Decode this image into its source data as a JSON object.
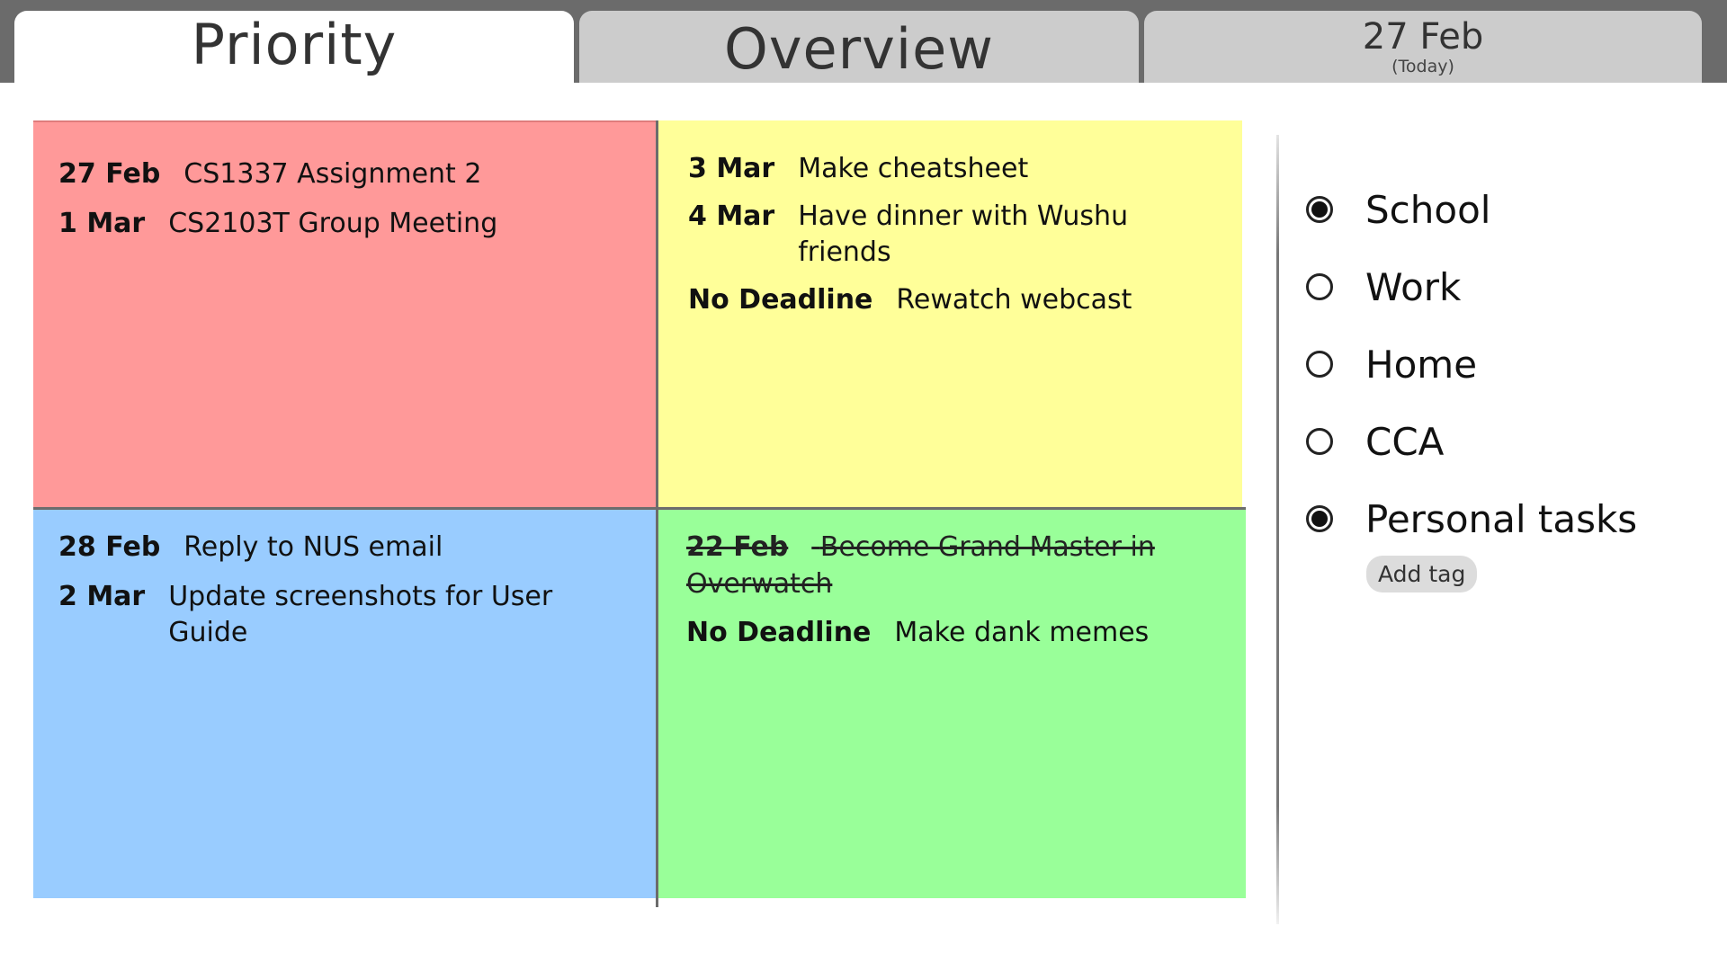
{
  "tabs": [
    {
      "label": "Priority",
      "active": true
    },
    {
      "label": "Overview",
      "active": false
    },
    {
      "label": "27 Feb",
      "sublabel": "(Today)",
      "active": false
    }
  ],
  "quadrants": {
    "red": {
      "color": "#ff9999",
      "tasks": [
        {
          "date": "27 Feb",
          "title": "CS1337 Assignment 2",
          "done": false
        },
        {
          "date": "1 Mar",
          "title": "CS2103T Group Meeting",
          "done": false
        }
      ]
    },
    "yellow": {
      "color": "#ffff99",
      "tasks": [
        {
          "date": "3 Mar",
          "title": "Make cheatsheet",
          "done": false
        },
        {
          "date": "4 Mar",
          "title": "Have dinner with Wushu friends",
          "done": false
        },
        {
          "date": "No Deadline",
          "title": "Rewatch webcast",
          "done": false
        }
      ]
    },
    "blue": {
      "color": "#99ccff",
      "tasks": [
        {
          "date": "28 Feb",
          "title": "Reply to NUS email",
          "done": false
        },
        {
          "date": "2 Mar",
          "title": "Update screenshots for User Guide",
          "done": false
        }
      ]
    },
    "green": {
      "color": "#99ff99",
      "tasks": [
        {
          "date": "22 Feb",
          "title": "Become Grand Master in Overwatch",
          "done": true
        },
        {
          "date": "No Deadline",
          "title": "Make dank memes",
          "done": false
        }
      ]
    }
  },
  "tags": [
    {
      "label": "School",
      "selected": true
    },
    {
      "label": "Work",
      "selected": false
    },
    {
      "label": "Home",
      "selected": false
    },
    {
      "label": "CCA",
      "selected": false
    },
    {
      "label": "Personal tasks",
      "selected": true
    }
  ],
  "add_tag_label": "Add tag"
}
